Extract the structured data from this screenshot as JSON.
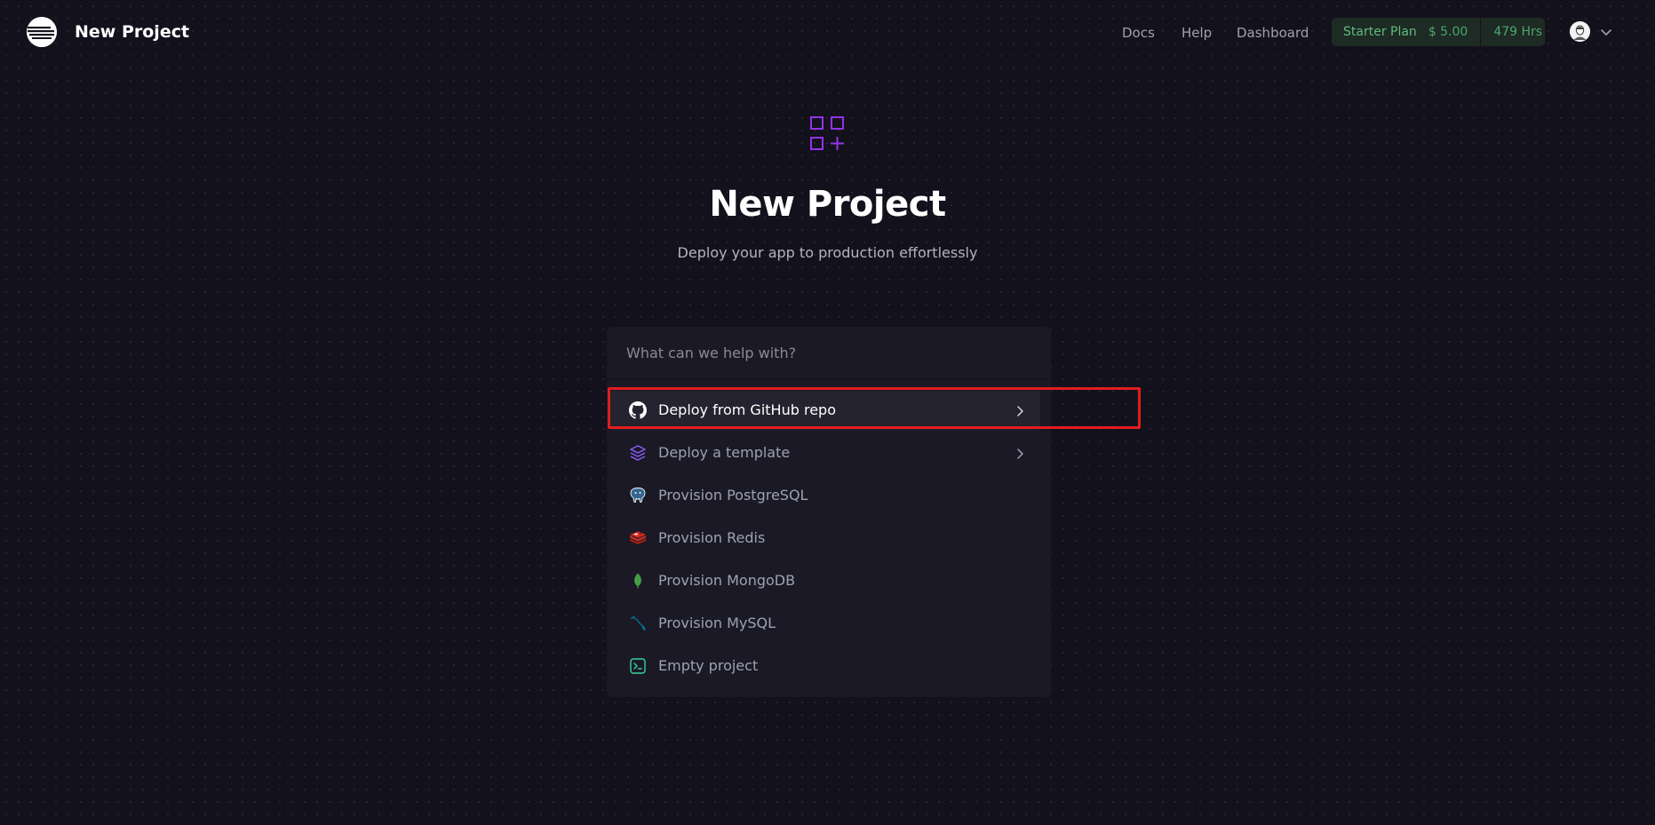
{
  "header": {
    "title": "New Project",
    "nav": {
      "docs": "Docs",
      "help": "Help",
      "dashboard": "Dashboard"
    },
    "plan": {
      "name": "Starter Plan",
      "money": "$ 5.00",
      "hours": "479 Hrs"
    }
  },
  "hero": {
    "title": "New Project",
    "subtitle": "Deploy your app to production effortlessly"
  },
  "search": {
    "placeholder": "What can we help with?",
    "value": ""
  },
  "options": [
    {
      "label": "Deploy from GitHub repo",
      "icon": "github-icon",
      "has_chevron": true,
      "active": true
    },
    {
      "label": "Deploy a template",
      "icon": "layers-icon",
      "has_chevron": true
    },
    {
      "label": "Provision PostgreSQL",
      "icon": "postgresql-icon"
    },
    {
      "label": "Provision Redis",
      "icon": "redis-icon"
    },
    {
      "label": "Provision MongoDB",
      "icon": "mongodb-icon"
    },
    {
      "label": "Provision MySQL",
      "icon": "mysql-icon"
    },
    {
      "label": "Empty project",
      "icon": "terminal-icon"
    }
  ],
  "colors": {
    "background": "#13111c",
    "panel": "#1b1926",
    "accent_purple": "#9333ea",
    "plan_green": "#4ade80",
    "highlight_red": "#e11d1d"
  }
}
